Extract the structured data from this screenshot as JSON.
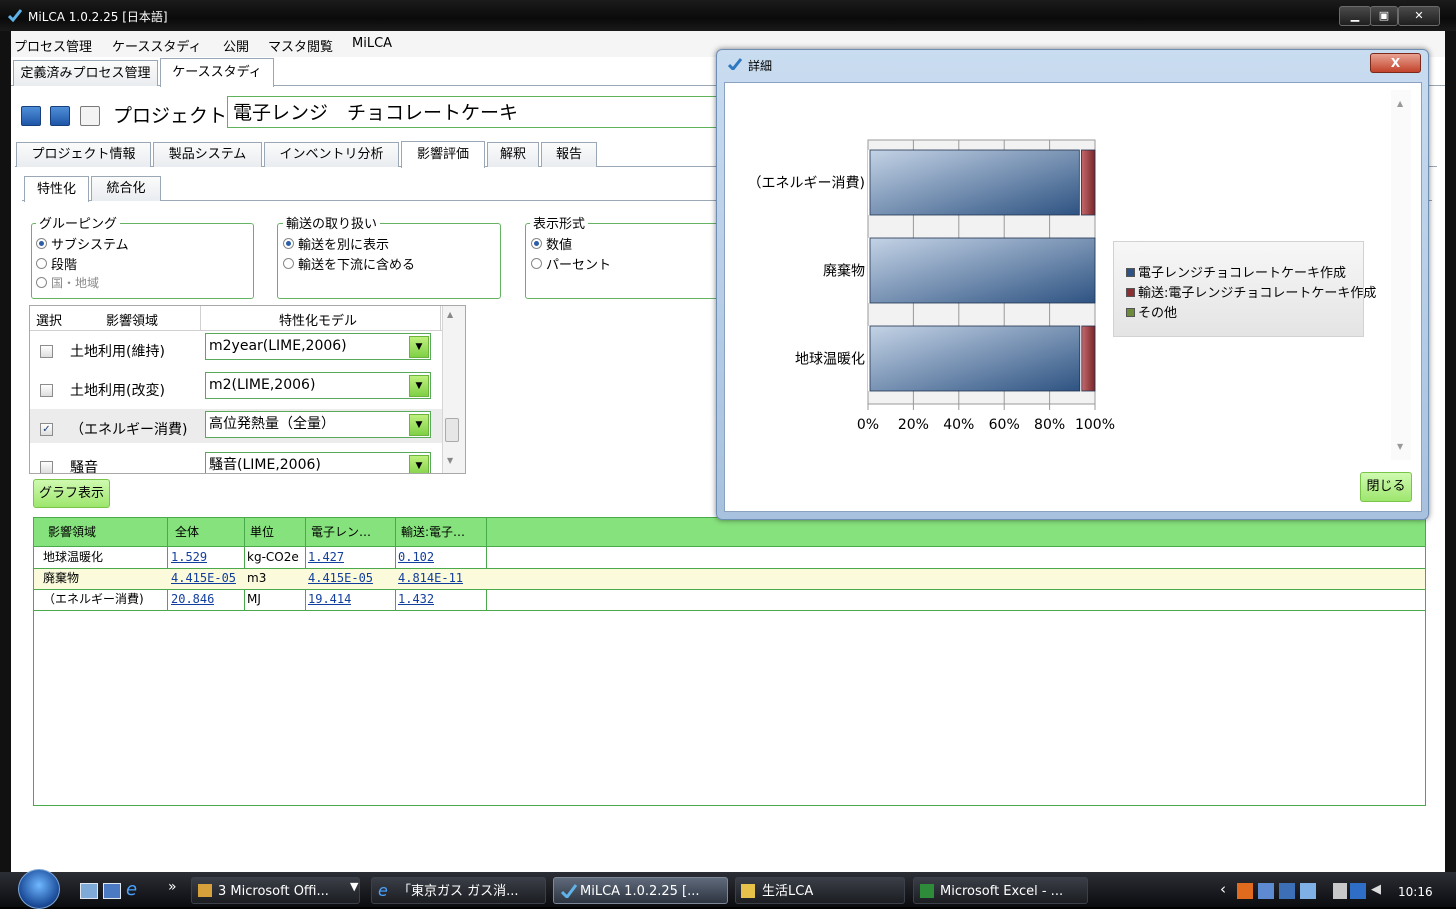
{
  "window": {
    "title": "MiLCA 1.0.2.25 [日本語]",
    "min": "▁",
    "max": "▣",
    "close": "✕"
  },
  "menu": [
    "プロセス管理",
    "ケーススタディ",
    "公開",
    "マスタ閲覧",
    "MiLCA"
  ],
  "main_tabs": [
    "定義済みプロセス管理",
    "ケーススタディ"
  ],
  "project": {
    "label": "プロジェクト",
    "name": "電子レンジ　チョコレートケーキ"
  },
  "section_tabs": [
    "プロジェクト情報",
    "製品システム",
    "インベントリ分析",
    "影響評価",
    "解釈",
    "報告"
  ],
  "sub_tabs": [
    "特性化",
    "統合化"
  ],
  "grouping": {
    "title": "グルーピング",
    "options": [
      "サブシステム",
      "段階",
      "国・地域"
    ]
  },
  "transport": {
    "title": "輸送の取り扱い",
    "options": [
      "輸送を別に表示",
      "輸送を下流に含める"
    ]
  },
  "display": {
    "title": "表示形式",
    "options": [
      "数値",
      "パーセント"
    ]
  },
  "grid": {
    "headers": [
      "選択",
      "影響領域",
      "特性化モデル"
    ],
    "rows": [
      {
        "checked": false,
        "area": "土地利用(維持)",
        "model": "m2year(LIME,2006)"
      },
      {
        "checked": false,
        "area": "土地利用(改変)",
        "model": "m2(LIME,2006)"
      },
      {
        "checked": true,
        "area": "（エネルギー消費)",
        "model": "高位発熱量（全量）"
      },
      {
        "checked": false,
        "area": "騒音",
        "model": "騒音(LIME,2006)"
      }
    ]
  },
  "graph_button": "グラフ表示",
  "results": {
    "headers": [
      "影響領域",
      "全体",
      "単位",
      "電子レン…",
      "輸送:電子…"
    ],
    "rows": [
      [
        "地球温暖化",
        "1.529",
        "kg-CO2e",
        "1.427",
        "0.102"
      ],
      [
        "廃棄物",
        "4.415E-05",
        "m3",
        "4.415E-05",
        "4.814E-11"
      ],
      [
        "（エネルギー消費)",
        "20.846",
        "MJ",
        "19.414",
        "1.432"
      ]
    ]
  },
  "dialog": {
    "title": "詳細",
    "close_x": "X",
    "close_button": "閉じる"
  },
  "chart_data": {
    "type": "bar",
    "orientation": "horizontal-stacked-100",
    "categories": [
      "（エネルギー消費)",
      "廃棄物",
      "地球温暖化"
    ],
    "series": [
      {
        "name": "電子レンジチョコレートケーキ作成",
        "values": [
          93.1,
          100.0,
          93.3
        ],
        "color": "#2e5382"
      },
      {
        "name": "輸送:電子レンジチョコレートケーキ作成",
        "values": [
          6.9,
          0.0,
          6.7
        ],
        "color": "#8c2f33"
      },
      {
        "name": "その他",
        "values": [
          0,
          0,
          0
        ],
        "color": "#6b8a3a"
      }
    ],
    "xticks": [
      "0%",
      "20%",
      "40%",
      "60%",
      "80%",
      "100%"
    ],
    "xlim": [
      0,
      100
    ],
    "legend": "right"
  },
  "taskbar": {
    "items": [
      "3 Microsoft Offi...",
      "「東京ガス ガス消...",
      "MiLCA 1.0.2.25 [...",
      "生活LCA",
      "Microsoft Excel - ..."
    ],
    "time": "10:16",
    "chevron": "»",
    "tray_arrow": "‹"
  }
}
